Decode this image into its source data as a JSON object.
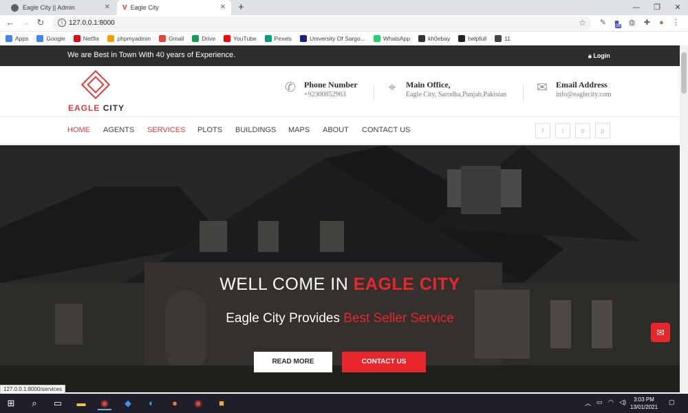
{
  "browser": {
    "tabs": [
      {
        "title": "Eagle City || Admin"
      },
      {
        "title": "Eagle City"
      }
    ],
    "url": "127.0.0.1:8000",
    "ext_badge": "26",
    "bookmarks": [
      {
        "label": "Apps",
        "color": "#4285f4"
      },
      {
        "label": "Google",
        "color": "#4285f4"
      },
      {
        "label": "Netflix",
        "color": "#e50914"
      },
      {
        "label": "phpmyadmin",
        "color": "#f89c0e"
      },
      {
        "label": "Gmail",
        "color": "#ea4335"
      },
      {
        "label": "Drive",
        "color": "#0f9d58"
      },
      {
        "label": "YouTube",
        "color": "#ff0000"
      },
      {
        "label": "Pexels",
        "color": "#05a081"
      },
      {
        "label": "University Of Sargo...",
        "color": "#1a237e"
      },
      {
        "label": "WhatsApp",
        "color": "#25d366"
      },
      {
        "label": "kh0ebay",
        "color": "#333333"
      },
      {
        "label": "helpfull",
        "color": "#222222"
      },
      {
        "label": "11",
        "color": "#444444"
      }
    ],
    "status_url": "127.0.0.1:8000/services"
  },
  "site": {
    "tagline": "We are Best in Town With 40 years of Experience.",
    "login": "Login",
    "logo": {
      "first": "EAGLE",
      "second": "CITY"
    },
    "contact": {
      "phone_title": "Phone Number",
      "phone_value": "+92300852963",
      "office_title": "Main Office,",
      "office_value": "Eagle City, Sarodha,Punjab,Pakistan",
      "email_title": "Email Address",
      "email_value": "info@eaglecity.com"
    },
    "nav": [
      "HOME",
      "AGENTS",
      "SERVICES",
      "PLOTS",
      "BUILDINGS",
      "MAPS",
      "ABOUT",
      "CONTACT US"
    ],
    "social": [
      "f",
      "t",
      "o",
      "p"
    ],
    "hero": {
      "heading_pre": "WELL COME IN",
      "heading_red": "EAGLE CITY",
      "sub_pre": "Eagle City Provides",
      "sub_red": "Best Seller Service",
      "btn_read": "READ MORE",
      "btn_contact": "CONTACT US"
    }
  },
  "taskbar": {
    "time": "3:03 PM",
    "date": "13/01/2021"
  },
  "colors": {
    "accent": "#e8262b",
    "dark": "#2d2d2d"
  }
}
